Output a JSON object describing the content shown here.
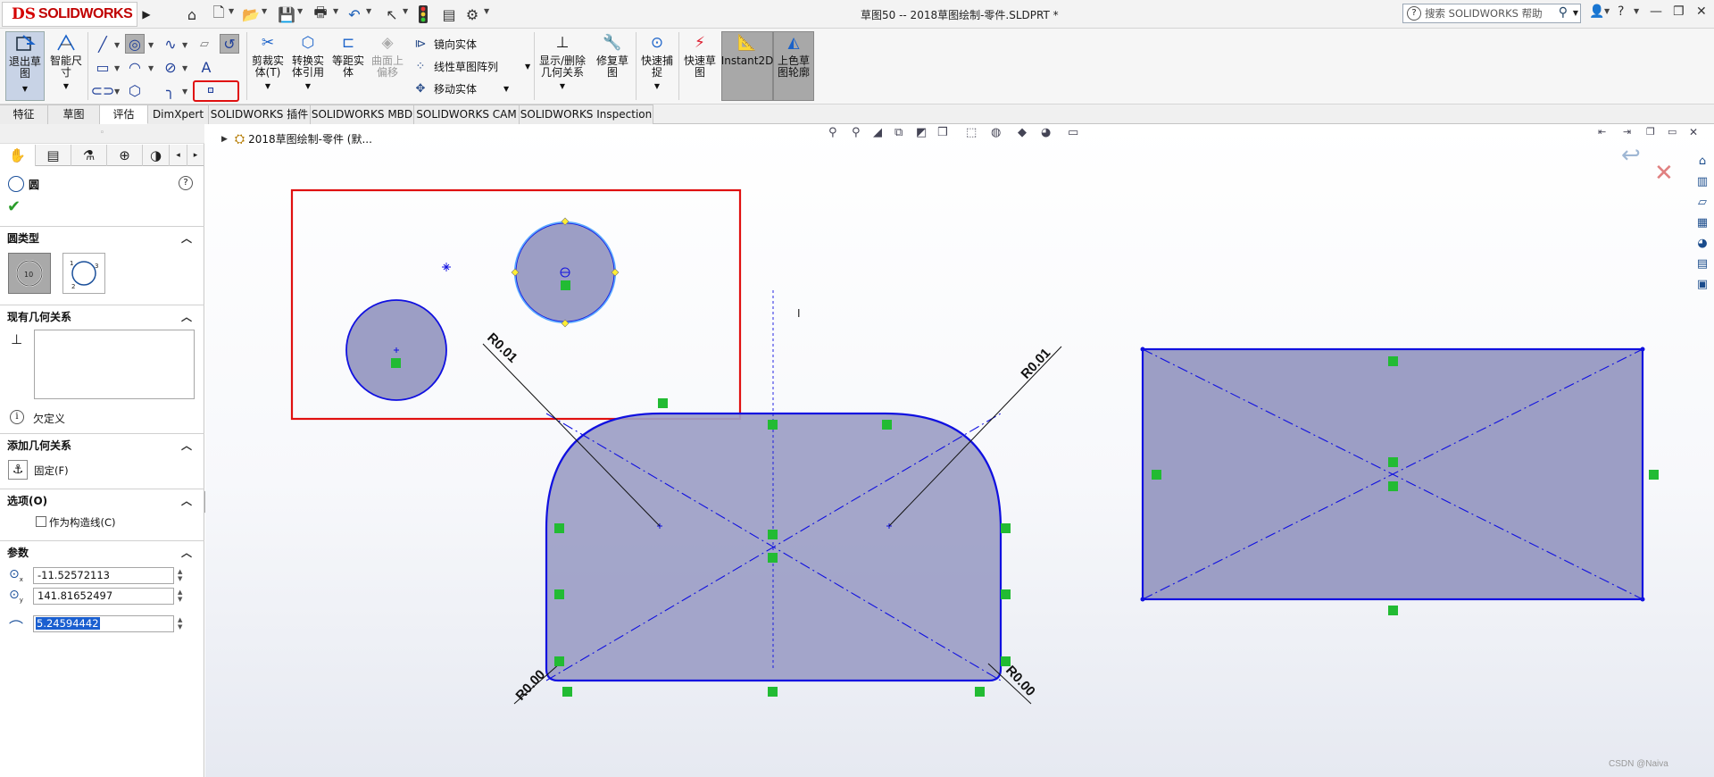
{
  "titlebar": {
    "logo_mark": "DS",
    "logo_text": "SOLIDWORKS",
    "doc_title": "草图50 -- 2018草图绘制-零件.SLDPRT *",
    "search_placeholder": "搜索 SOLIDWORKS 帮助",
    "help_mark": "?"
  },
  "ribbon": {
    "exit_sketch": "退出草图",
    "smart_dim": "智能尺寸",
    "trim": "剪裁实体(T)",
    "convert": "转换实体引用",
    "offset": "等距实体",
    "surface_offset": "曲面上偏移",
    "mirror": "镜向实体",
    "linear_pattern": "线性草图阵列",
    "move": "移动实体",
    "show_delete_relations": "显示/删除几何关系",
    "repair": "修复草图",
    "quick_snap": "快速捕捉",
    "rapid_sketch": "快速草图",
    "instant2d": "Instant2D",
    "shaded_contours": "上色草图轮廓"
  },
  "tabs": [
    {
      "label": "特征"
    },
    {
      "label": "草图"
    },
    {
      "label": "评估"
    },
    {
      "label": "DimXpert"
    },
    {
      "label": "SOLIDWORKS 插件"
    },
    {
      "label": "SOLIDWORKS MBD"
    },
    {
      "label": "SOLIDWORKS CAM"
    },
    {
      "label": "SOLIDWORKS Inspection"
    }
  ],
  "panel": {
    "title": "圆",
    "circle_type_header": "圆类型",
    "existing_relations_header": "现有几何关系",
    "status_text": "欠定义",
    "add_relations_header": "添加几何关系",
    "fix_label": "固定(F)",
    "options_header": "选项(O)",
    "construction_label": "作为构造线(C)",
    "params_header": "参数",
    "cx": "-11.52572113",
    "cy": "141.81652497",
    "radius": "5.24594442"
  },
  "tree": {
    "label": "2018草图绘制-零件 (默..."
  },
  "sketch": {
    "dim_labels": [
      "R0.01",
      "R0.01",
      "R0.00",
      "R0.00"
    ],
    "cursor_mark": "I"
  },
  "watermark": "CSDN @Naiva",
  "colors": {
    "sketch_line": "#1010e0",
    "sketch_fill": "#9c9ec5",
    "relation_green": "#22bb33",
    "highlight_red": "#e01010",
    "active_tool": "#a8a8a8"
  }
}
